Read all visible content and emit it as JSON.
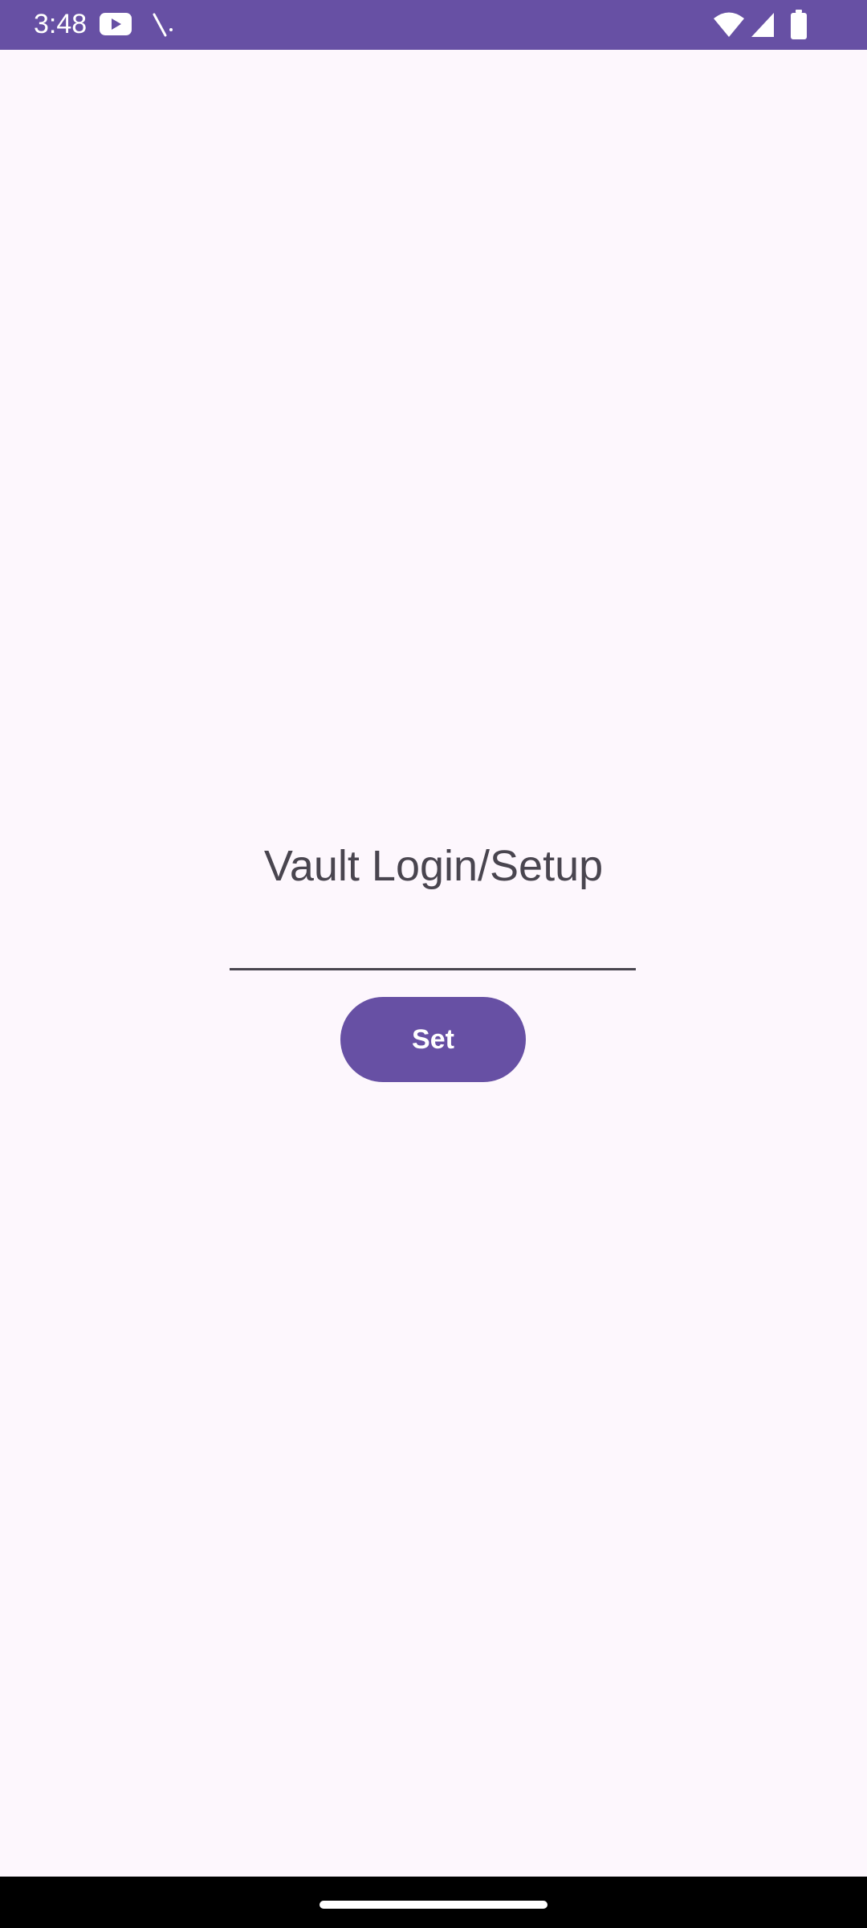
{
  "status_bar": {
    "time": "3:48",
    "background_color": "#6750A4",
    "icons": [
      "youtube-icon",
      "mic-off-icon",
      "wifi-icon",
      "signal-icon",
      "battery-icon"
    ]
  },
  "screen": {
    "title": "Vault Login/Setup",
    "password_field": {
      "value": "",
      "placeholder": ""
    },
    "set_button_label": "Set",
    "accent_color": "#6750A4",
    "background_color": "#FDF7FD"
  }
}
